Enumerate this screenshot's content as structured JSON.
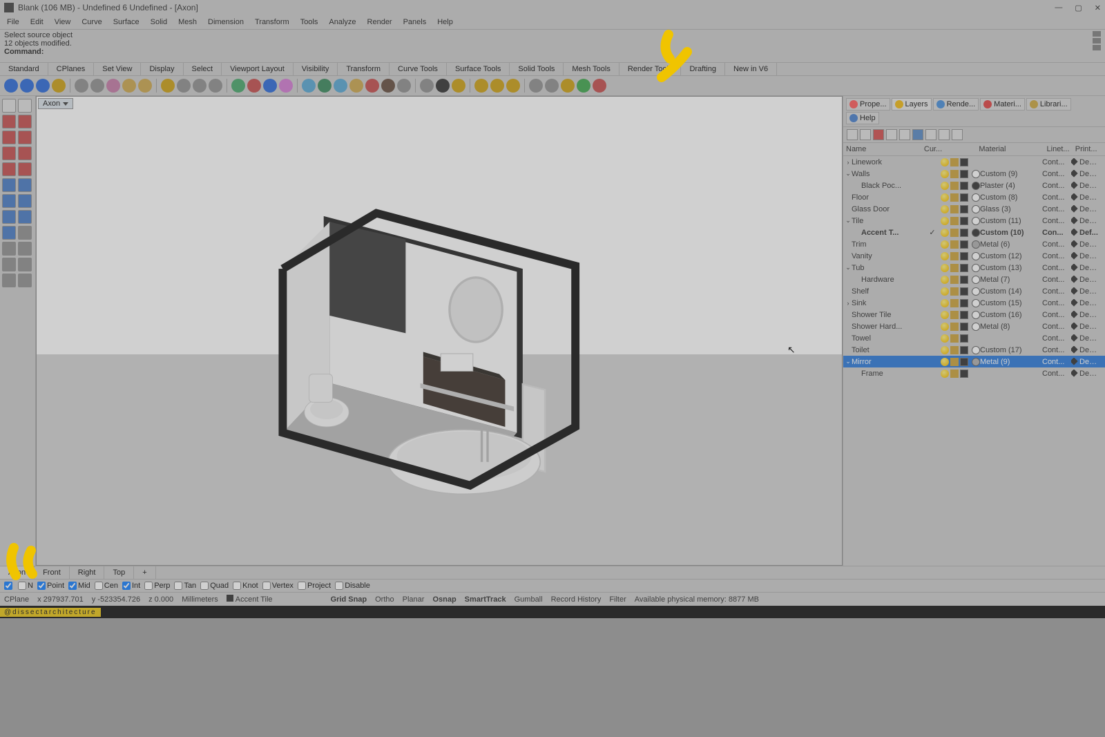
{
  "title": "Blank (106 MB) - Undefined 6 Undefined - [Axon]",
  "menus": [
    "File",
    "Edit",
    "View",
    "Curve",
    "Surface",
    "Solid",
    "Mesh",
    "Dimension",
    "Transform",
    "Tools",
    "Analyze",
    "Render",
    "Panels",
    "Help"
  ],
  "command_history": [
    "Select source object",
    "12 objects modified."
  ],
  "command_label": "Command:",
  "tabstrip": [
    "Standard",
    "CPlanes",
    "Set View",
    "Display",
    "Select",
    "Viewport Layout",
    "Visibility",
    "Transform",
    "Curve Tools",
    "Surface Tools",
    "Solid Tools",
    "Mesh Tools",
    "Render Tools",
    "Drafting",
    "New in V6"
  ],
  "viewport_label": "Axon",
  "panel_tabs": [
    {
      "label": "Prope...",
      "active": false,
      "color": "#ff4d4d"
    },
    {
      "label": "Layers",
      "active": true,
      "color": "#f0b400"
    },
    {
      "label": "Rende...",
      "active": false,
      "color": "#3a86d8"
    },
    {
      "label": "Materi...",
      "active": false,
      "color": "#d33"
    },
    {
      "label": "Librari...",
      "active": false,
      "color": "#c8a030"
    },
    {
      "label": "Help",
      "active": false,
      "color": "#3a76c8"
    }
  ],
  "layer_header": {
    "name": "Name",
    "cur": "Cur...",
    "mat": "Material",
    "lt": "Linet...",
    "pr": "Print..."
  },
  "layers": [
    {
      "indent": 0,
      "caret": ">",
      "name": "Linework",
      "cur": "",
      "swatch": "#222",
      "matdot": "none",
      "mat": "",
      "lt": "Cont...",
      "pr": "Defa..."
    },
    {
      "indent": 0,
      "caret": "v",
      "name": "Walls",
      "cur": "",
      "swatch": "#222",
      "matdot": "#fff",
      "mat": "Custom (9)",
      "lt": "Cont...",
      "pr": "Defa..."
    },
    {
      "indent": 1,
      "caret": "",
      "name": "Black Poc...",
      "cur": "",
      "swatch": "#222",
      "matdot": "#222",
      "mat": "Plaster (4)",
      "lt": "Cont...",
      "pr": "Defa..."
    },
    {
      "indent": 0,
      "caret": "",
      "name": "Floor",
      "cur": "",
      "swatch": "#222",
      "matdot": "#fff",
      "mat": "Custom (8)",
      "lt": "Cont...",
      "pr": "Defa..."
    },
    {
      "indent": 0,
      "caret": "",
      "name": "Glass Door",
      "cur": "",
      "swatch": "#222",
      "matdot": "#fff",
      "mat": "Glass (3)",
      "lt": "Cont...",
      "pr": "Defa..."
    },
    {
      "indent": 0,
      "caret": "v",
      "name": "Tile",
      "cur": "",
      "swatch": "#222",
      "matdot": "#fff",
      "mat": "Custom (11)",
      "lt": "Cont...",
      "pr": "Defa..."
    },
    {
      "indent": 1,
      "caret": "",
      "name": "Accent T...",
      "cur": "✓",
      "swatch": "#222",
      "matdot": "#222",
      "mat": "Custom (10)",
      "lt": "Con...",
      "pr": "Def...",
      "bold": true
    },
    {
      "indent": 0,
      "caret": "",
      "name": "Trim",
      "cur": "",
      "swatch": "#222",
      "matdot": "#aaa",
      "mat": "Metal (6)",
      "lt": "Cont...",
      "pr": "Defa..."
    },
    {
      "indent": 0,
      "caret": "",
      "name": "Vanity",
      "cur": "",
      "swatch": "#222",
      "matdot": "#fff",
      "mat": "Custom (12)",
      "lt": "Cont...",
      "pr": "Defa..."
    },
    {
      "indent": 0,
      "caret": "v",
      "name": "Tub",
      "cur": "",
      "swatch": "#222",
      "matdot": "#fff",
      "mat": "Custom (13)",
      "lt": "Cont...",
      "pr": "Defa..."
    },
    {
      "indent": 1,
      "caret": "",
      "name": "Hardware",
      "cur": "",
      "swatch": "#222",
      "matdot": "#fff",
      "mat": "Metal (7)",
      "lt": "Cont...",
      "pr": "Defa..."
    },
    {
      "indent": 0,
      "caret": "",
      "name": "Shelf",
      "cur": "",
      "swatch": "#222",
      "matdot": "#fff",
      "mat": "Custom (14)",
      "lt": "Cont...",
      "pr": "Defa..."
    },
    {
      "indent": 0,
      "caret": ">",
      "name": "Sink",
      "cur": "",
      "swatch": "#222",
      "matdot": "#fff",
      "mat": "Custom (15)",
      "lt": "Cont...",
      "pr": "Defa..."
    },
    {
      "indent": 0,
      "caret": "",
      "name": "Shower Tile",
      "cur": "",
      "swatch": "#222",
      "matdot": "#fff",
      "mat": "Custom (16)",
      "lt": "Cont...",
      "pr": "Defa..."
    },
    {
      "indent": 0,
      "caret": "",
      "name": "Shower Hard...",
      "cur": "",
      "swatch": "#222",
      "matdot": "#fff",
      "mat": "Metal (8)",
      "lt": "Cont...",
      "pr": "Defa..."
    },
    {
      "indent": 0,
      "caret": "",
      "name": "Towel",
      "cur": "",
      "swatch": "#222",
      "matdot": "none",
      "mat": "",
      "lt": "Cont...",
      "pr": "Defa..."
    },
    {
      "indent": 0,
      "caret": "",
      "name": "Toilet",
      "cur": "",
      "swatch": "#222",
      "matdot": "#fff",
      "mat": "Custom (17)",
      "lt": "Cont...",
      "pr": "Defa..."
    },
    {
      "indent": 0,
      "caret": "v",
      "name": "Mirror",
      "cur": "",
      "swatch": "#222",
      "matdot": "#aaa",
      "mat": "Metal (9)",
      "lt": "Cont...",
      "pr": "Defa...",
      "selected": true
    },
    {
      "indent": 1,
      "caret": "",
      "name": "Frame",
      "cur": "",
      "swatch": "#222",
      "matdot": "none",
      "mat": "",
      "lt": "Cont...",
      "pr": "Defa..."
    }
  ],
  "bottom_tabs": [
    "Axon",
    "Front",
    "Right",
    "Top",
    "+"
  ],
  "osnap": [
    {
      "label": "",
      "checked": true
    },
    {
      "label": "N",
      "checked": false
    },
    {
      "label": "Point",
      "checked": true
    },
    {
      "label": "Mid",
      "checked": true
    },
    {
      "label": "Cen",
      "checked": false
    },
    {
      "label": "Int",
      "checked": true
    },
    {
      "label": "Perp",
      "checked": false
    },
    {
      "label": "Tan",
      "checked": false
    },
    {
      "label": "Quad",
      "checked": false
    },
    {
      "label": "Knot",
      "checked": false
    },
    {
      "label": "Vertex",
      "checked": false
    },
    {
      "label": "Project",
      "checked": false
    },
    {
      "label": "Disable",
      "checked": false
    }
  ],
  "status": {
    "cplane": "CPlane",
    "x": "x 297937.701",
    "y": "y -523354.726",
    "z": "z 0.000",
    "units": "Millimeters",
    "layer": "Accent Tile",
    "items": [
      "Grid Snap",
      "Ortho",
      "Planar",
      "Osnap",
      "SmartTrack",
      "Gumball",
      "Record History",
      "Filter"
    ],
    "bold_items": [
      "Grid Snap",
      "Osnap",
      "SmartTrack"
    ],
    "mem": "Available physical memory: 8877 MB"
  },
  "footer": "@dissectarchitecture"
}
